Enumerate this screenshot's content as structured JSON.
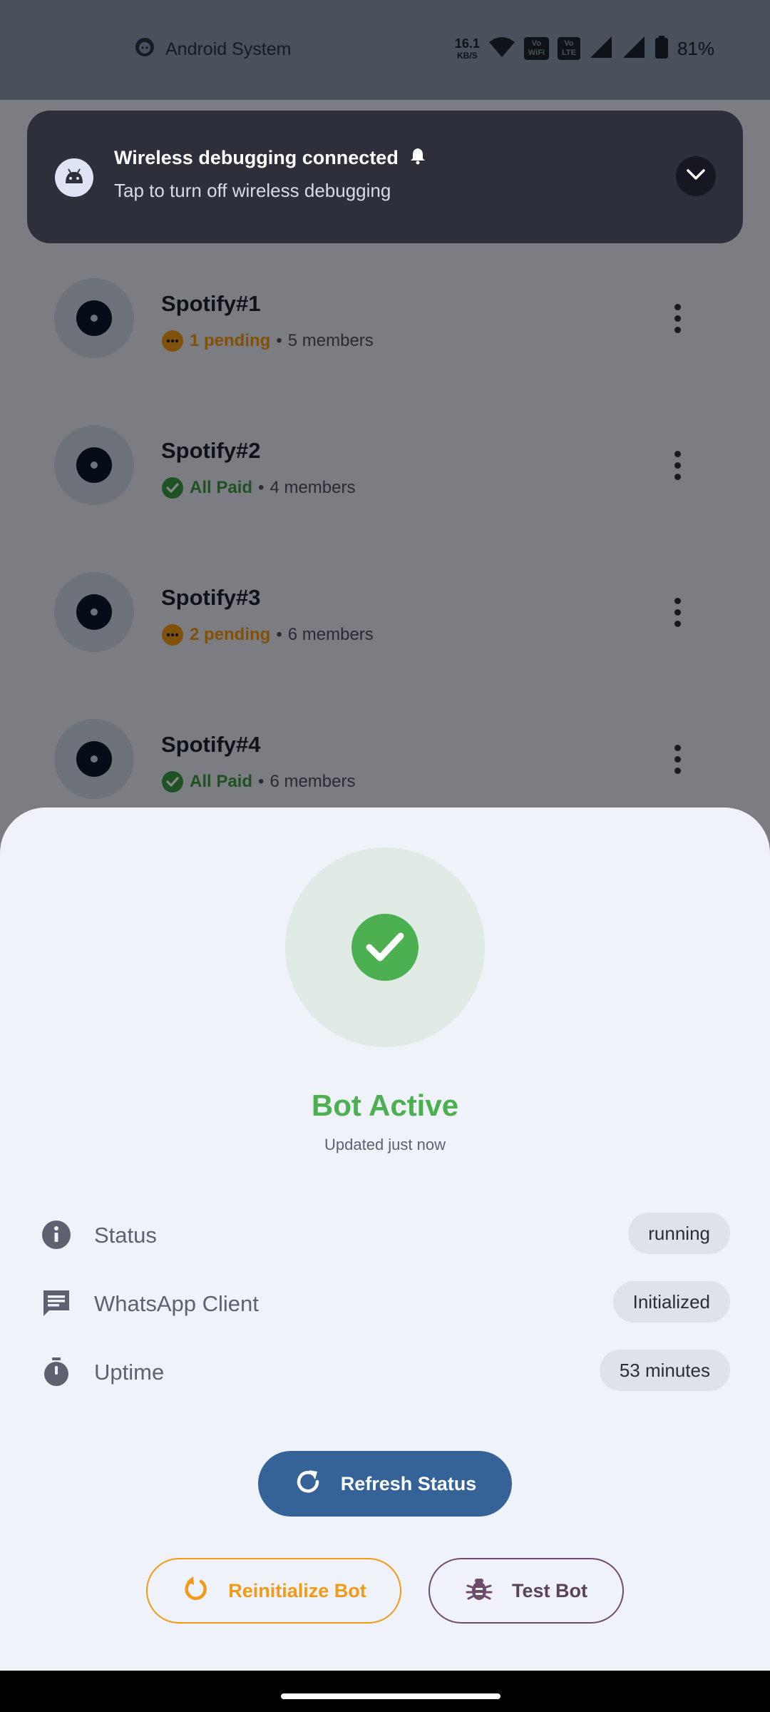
{
  "status_bar": {
    "system_label": "Android System",
    "speed_value": "16.1",
    "speed_unit": "KB/S",
    "wifi_chip_top": "Vo",
    "wifi_chip_bottom": "WiFi",
    "lte_chip_top": "Vo",
    "lte_chip_bottom": "LTE",
    "battery": "81%"
  },
  "notification": {
    "title": "Wireless debugging connected",
    "text": "Tap to turn off wireless debugging"
  },
  "groups": [
    {
      "name": "Spotify#1",
      "status": "1 pending",
      "status_kind": "pending",
      "members": "5 members"
    },
    {
      "name": "Spotify#2",
      "status": "All Paid",
      "status_kind": "paid",
      "members": "4 members"
    },
    {
      "name": "Spotify#3",
      "status": "2 pending",
      "status_kind": "pending",
      "members": "6 members"
    },
    {
      "name": "Spotify#4",
      "status": "All Paid",
      "status_kind": "paid",
      "members": "6 members"
    }
  ],
  "separator": "•",
  "sheet": {
    "title": "Bot Active",
    "updated": "Updated just now",
    "rows": [
      {
        "label": "Status",
        "value": "running",
        "icon": "info-icon"
      },
      {
        "label": "WhatsApp Client",
        "value": "Initialized",
        "icon": "chat-icon"
      },
      {
        "label": "Uptime",
        "value": "53 minutes",
        "icon": "timer-icon"
      }
    ],
    "refresh_label": "Refresh Status",
    "reinit_label": "Reinitialize Bot",
    "test_label": "Test Bot"
  },
  "colors": {
    "success": "#4caf50",
    "pending": "#f29a14",
    "primary": "#356398",
    "test_outline": "#6d4b6c"
  }
}
